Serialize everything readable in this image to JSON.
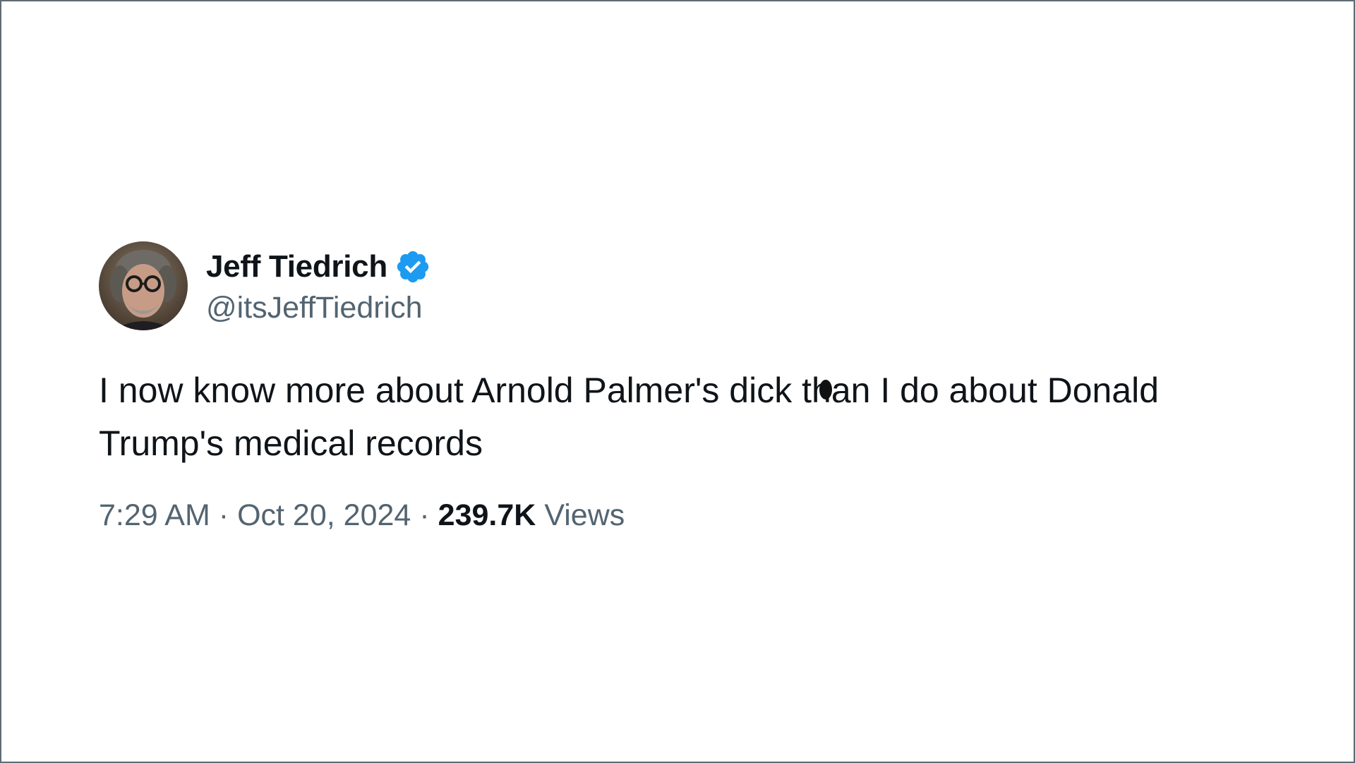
{
  "author": {
    "display_name": "Jeff Tiedrich",
    "handle": "@itsJeffTiedrich",
    "verified_badge_icon": "verified-checkmark-icon",
    "badge_color": "#1d9bf0"
  },
  "tweet": {
    "text": "I now know more about Arnold Palmer's dick than I do about Donald Trump's medical records",
    "time": "7:29 AM",
    "date": "Oct 20, 2024",
    "separator": "·",
    "views_count": "239.7K",
    "views_label": "Views"
  },
  "colors": {
    "text_primary": "#0f1419",
    "text_secondary": "#536471",
    "frame_border": "#5f6b73"
  }
}
